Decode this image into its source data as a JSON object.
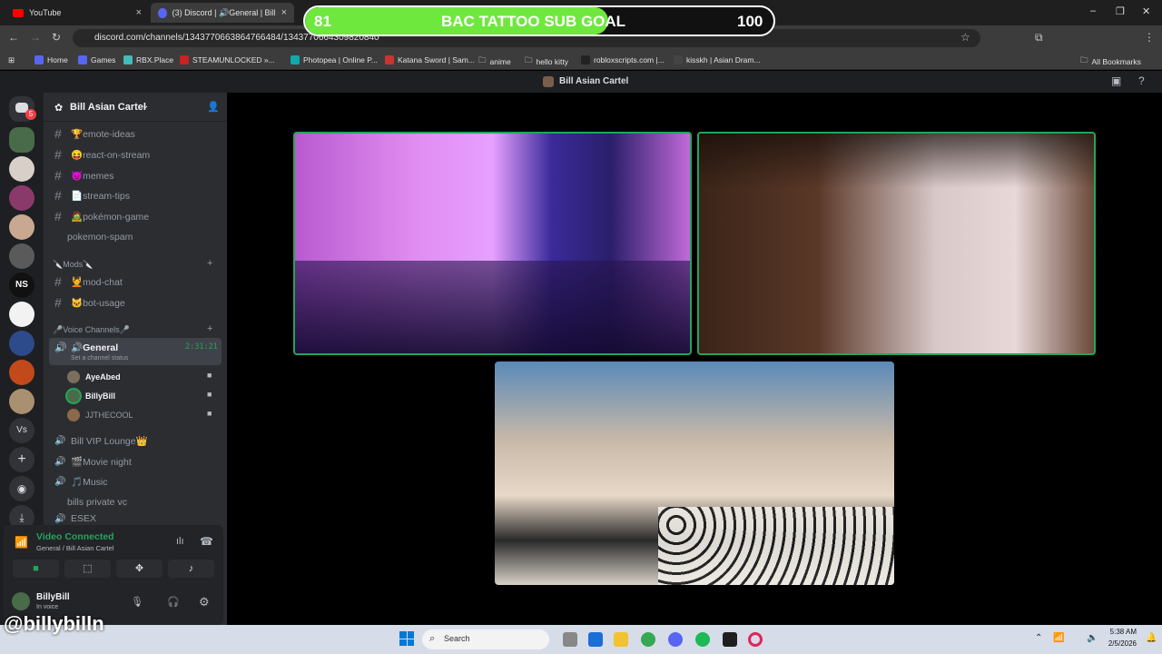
{
  "browser": {
    "tabs": [
      {
        "label": "YouTube",
        "close": "×"
      },
      {
        "label": "(3) Discord | 🔊General | Bill",
        "close": "×"
      }
    ],
    "new_tab": "+",
    "window_controls": {
      "minimize": "–",
      "restore": "❐",
      "close": "✕"
    },
    "url": "discord.com/channels/1343770663864766484/1343770664309820840",
    "bookmarks": [
      "Home",
      "Games",
      "RBX.Place",
      "STEAMUNLOCKED »...",
      "Photopea | Online P...",
      "Katana Sword | Sam...",
      "anime",
      "hello kitty",
      "robloxscripts.com |...",
      "kisskh | Asian Dram...",
      "All Bookmarks"
    ]
  },
  "sub_goal": {
    "current": "81",
    "title": "BAC TATTOO SUB GOAL",
    "target": "100",
    "progress": 0.81
  },
  "discord": {
    "header_title": "Bill Asian Cartel",
    "guild_badge": "5",
    "guild_text_1": "NS",
    "guild_text_2": "Vs",
    "server_name": "Bill Asian Cartel",
    "text_channels": [
      "🏆emote-ideas",
      "😝react-on-stream",
      "😈memes",
      "📄stream-tips",
      "🧟pokémon-game",
      "pokemon-spam"
    ],
    "mods_category": "🔪Mods🔪",
    "mod_channels": [
      "💆mod-chat",
      "🐱bot-usage"
    ],
    "voice_category": "🎤Voice Channels🎤",
    "active_voice": {
      "name": "🔊General",
      "timer": "2:31:21",
      "status_hint": "Set a channel status"
    },
    "voice_users": [
      "AyeAbed",
      "BillyBill",
      "JJTHECOOL"
    ],
    "voice_channels": [
      "Bill VIP Lounge👑",
      "🎬Movie night",
      "🎵Music",
      "bills private vc",
      "ESEX"
    ],
    "connection": {
      "status": "Video Connected",
      "location": "General / Bill Asian Cartel"
    },
    "user": {
      "name": "BillyBill",
      "status": "In voice"
    }
  },
  "taskbar": {
    "search_placeholder": "Search",
    "time": "5:38 AM",
    "date": "2/5/2026"
  },
  "overlay_handle": "@billybilln",
  "colors": {
    "accent_green": "#23a55a",
    "goal_fill": "#6ee83d",
    "discord_bg": "#2b2d31"
  }
}
